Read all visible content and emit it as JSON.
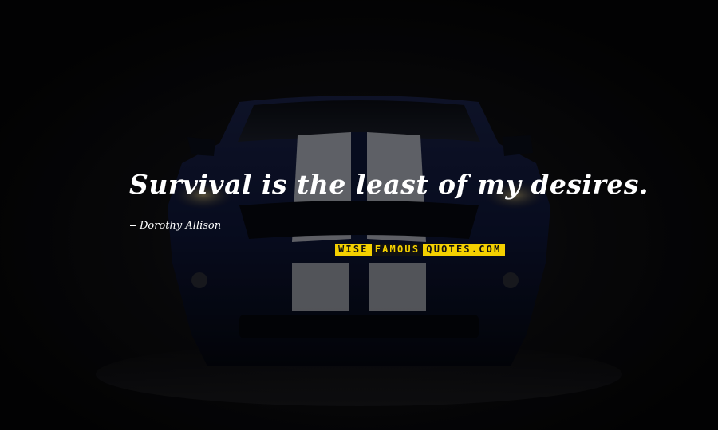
{
  "quote": {
    "text": "Survival is the least of my desires.",
    "author": "Dorothy Allison"
  },
  "watermark": {
    "part1": "WISE",
    "part2": "FAMOUS",
    "part3": "QUOTES.COM",
    "colors": {
      "yellow": "#f4d000",
      "dark": "#111111"
    }
  },
  "background": {
    "subject": "car-front",
    "stripe_color": "#b9bcc4",
    "body_color": "#0e1638"
  }
}
